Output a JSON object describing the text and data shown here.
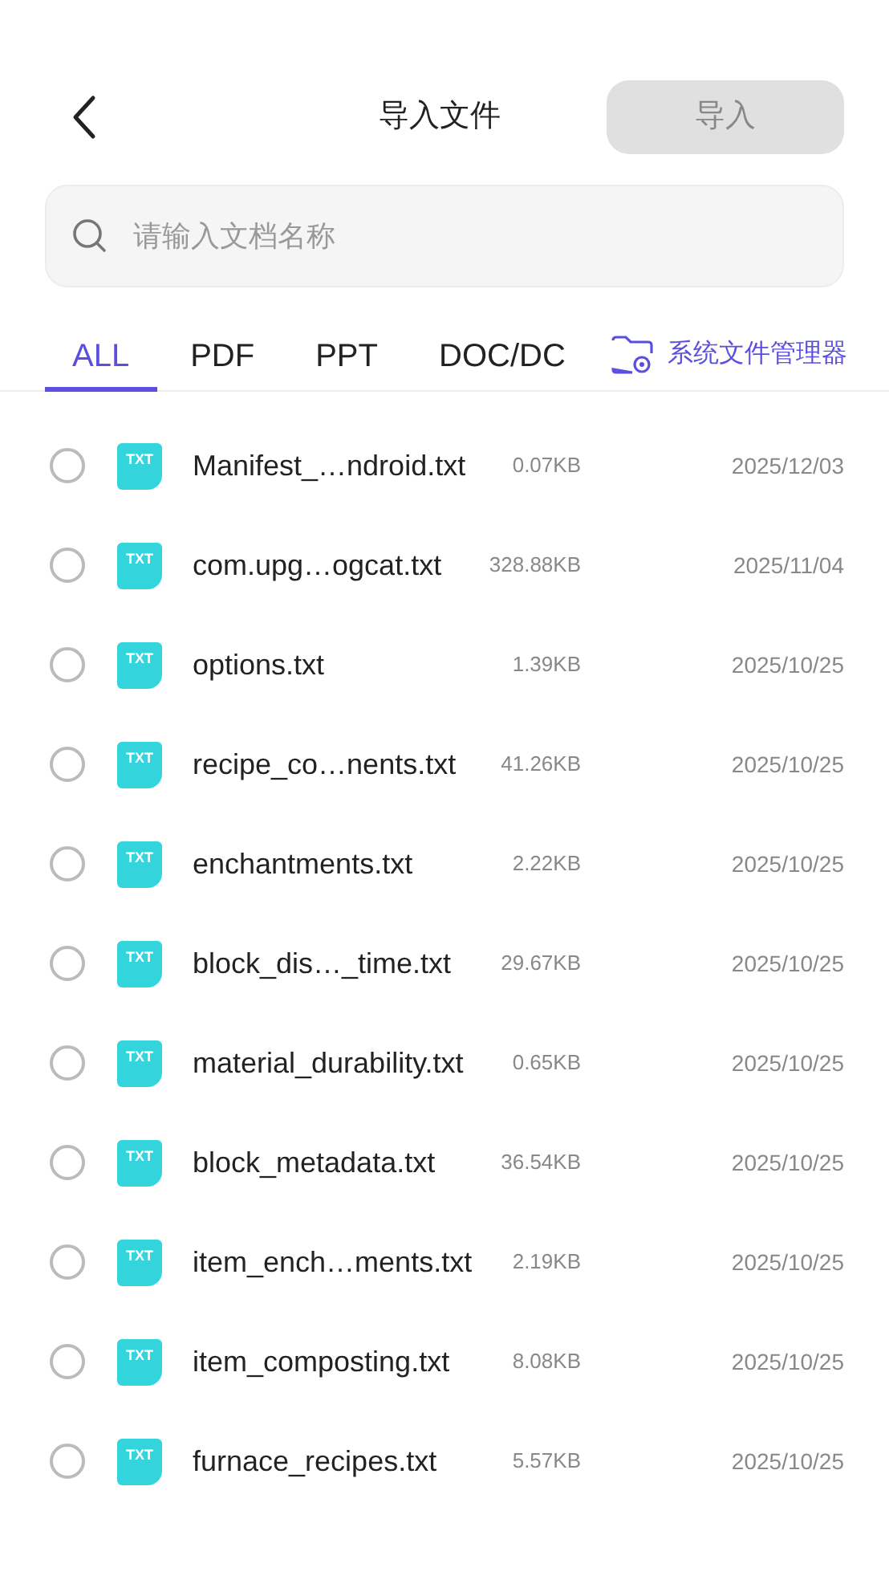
{
  "header": {
    "title": "导入文件",
    "import_button": {
      "label": "导入",
      "disabled": true
    }
  },
  "search": {
    "placeholder": "请输入文档名称"
  },
  "tabs": [
    {
      "label": "ALL",
      "selected": true
    },
    {
      "label": "PDF",
      "selected": false
    },
    {
      "label": "PPT",
      "selected": false
    },
    {
      "label": "DOC/DC",
      "selected": false
    }
  ],
  "file_manager_link": "系统文件管理器",
  "files": [
    {
      "type": "TXT",
      "name": "Manifest_…ndroid.txt",
      "size": "0.07KB",
      "date": "2025/12/03",
      "selected": false
    },
    {
      "type": "TXT",
      "name": "com.upg…ogcat.txt",
      "size": "328.88KB",
      "date": "2025/11/04",
      "selected": false
    },
    {
      "type": "TXT",
      "name": "options.txt",
      "size": "1.39KB",
      "date": "2025/10/25",
      "selected": false
    },
    {
      "type": "TXT",
      "name": "recipe_co…nents.txt",
      "size": "41.26KB",
      "date": "2025/10/25",
      "selected": false
    },
    {
      "type": "TXT",
      "name": "enchantments.txt",
      "size": "2.22KB",
      "date": "2025/10/25",
      "selected": false
    },
    {
      "type": "TXT",
      "name": "block_dis…_time.txt",
      "size": "29.67KB",
      "date": "2025/10/25",
      "selected": false
    },
    {
      "type": "TXT",
      "name": "material_durability.txt",
      "size": "0.65KB",
      "date": "2025/10/25",
      "selected": false
    },
    {
      "type": "TXT",
      "name": "block_metadata.txt",
      "size": "36.54KB",
      "date": "2025/10/25",
      "selected": false
    },
    {
      "type": "TXT",
      "name": "item_ench…ments.txt",
      "size": "2.19KB",
      "date": "2025/10/25",
      "selected": false
    },
    {
      "type": "TXT",
      "name": "item_composting.txt",
      "size": "8.08KB",
      "date": "2025/10/25",
      "selected": false
    },
    {
      "type": "TXT",
      "name": "furnace_recipes.txt",
      "size": "5.57KB",
      "date": "2025/10/25",
      "selected": false
    }
  ]
}
